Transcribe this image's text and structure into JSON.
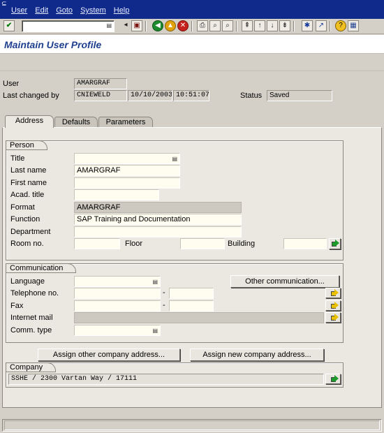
{
  "menu": [
    "User",
    "Edit",
    "Goto",
    "System",
    "Help"
  ],
  "title": "Maintain User Profile",
  "header": {
    "user_label": "User",
    "user_value": "AMARGRAF",
    "changed_label": "Last changed by",
    "changed_by": "CNIEWELD",
    "changed_date": "10/10/2003",
    "changed_time": "10:51:07",
    "status_label": "Status",
    "status_value": "Saved"
  },
  "tabs": [
    "Address",
    "Defaults",
    "Parameters"
  ],
  "person": {
    "title": "Person",
    "title_label": "Title",
    "title_value": "",
    "last_name_label": "Last name",
    "last_name_value": "AMARGRAF",
    "first_name_label": "First name",
    "first_name_value": "",
    "acad_title_label": "Acad. title",
    "acad_title_value": "",
    "format_label": "Format",
    "format_value": "AMARGRAF",
    "function_label": "Function",
    "function_value": "SAP Training and Documentation",
    "department_label": "Department",
    "department_value": "",
    "room_label": "Room no.",
    "room_value": "",
    "floor_label": "Floor",
    "floor_value": "",
    "building_label": "Building",
    "building_value": ""
  },
  "communication": {
    "title": "Communication",
    "language_label": "Language",
    "language_value": "",
    "telephone_label": "Telephone no.",
    "telephone_value": "",
    "telephone_ext": "",
    "fax_label": "Fax",
    "fax_value": "",
    "fax_ext": "",
    "internet_label": "Internet mail",
    "internet_value": "",
    "comm_type_label": "Comm. type",
    "comm_type_value": "",
    "other_comm_button": "Other communication...",
    "dash": "-"
  },
  "buttons": {
    "assign_other": "Assign other company address...",
    "assign_new": "Assign new company address..."
  },
  "company": {
    "title": "Company",
    "value": "SSHE / 2300 Vartan Way / 17111"
  },
  "icons": {
    "enter": "check-icon",
    "save": "save-icon",
    "back": "back-icon",
    "exit": "exit-icon",
    "cancel": "cancel-icon"
  }
}
